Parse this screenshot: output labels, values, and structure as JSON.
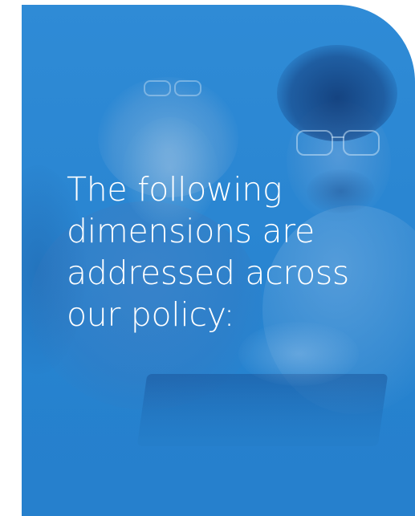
{
  "headline": {
    "text": "The following\ndimensions are\naddressed across\nour policy:"
  },
  "photo": {
    "icon": "people-photo-illustration"
  },
  "colors": {
    "overlay": "#2a86d2",
    "text": "#ffffff"
  }
}
